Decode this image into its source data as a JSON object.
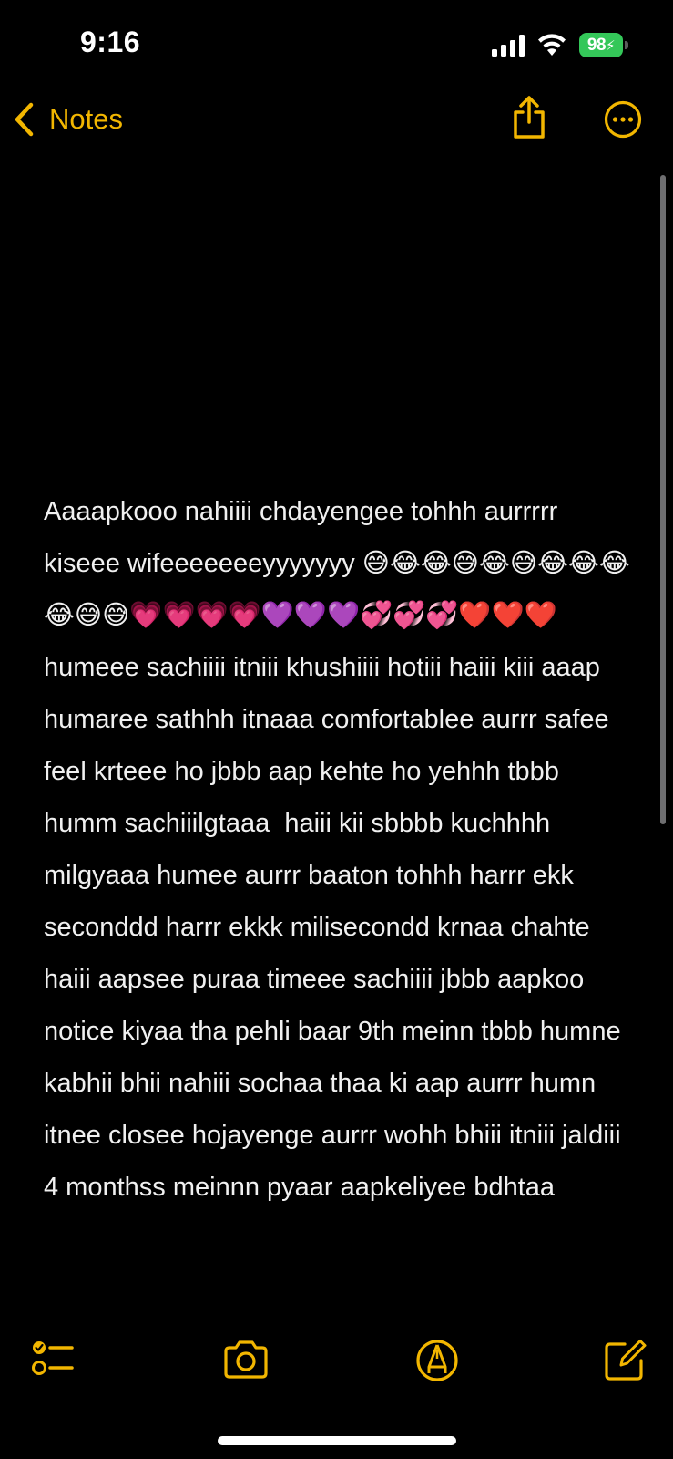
{
  "status_bar": {
    "time": "9:16",
    "battery_level": "98"
  },
  "nav": {
    "back_label": "Notes"
  },
  "note": {
    "body": "Aaaapkooo nahiiii chdayengee tohhh aurrrrr kiseee wifeeeeeeeyyyyyyy 😅😂😂😅😂😅😂😂😂😂😅😅💗💗💗💗💜💜💜💞💞💞❤️❤️❤️ humeee sachiiii itniii khushiiii hotiii haiii kiii aaap humaree sathhh itnaaa comfortablee aurrr safee feel krteee ho jbbb aap kehte ho yehhh tbbb humm sachiiilgtaaa  haiii kii sbbbb kuchhhh milgyaaa humee aurrr baaton tohhh harrr ekk seconddd harrr ekkk milisecondd krnaa chahte haiii aapsee puraa timeee sachiiii jbbb aapkoo notice kiyaa tha pehli baar 9th meinn tbbb humne kabhii bhii nahiii sochaa thaa ki aap aurrr humn itnee closee hojayenge aurrr wohh bhiii itniii jaldiii 4 monthss meinnn pyaar aapkeliyee bdhtaa"
  },
  "colors": {
    "accent": "#f2b600",
    "background": "#000000",
    "text": "#f0f0f0",
    "battery": "#34c759"
  },
  "icons": {
    "back": "chevron-left-icon",
    "share": "share-icon",
    "more": "ellipsis-circle-icon",
    "checklist": "checklist-icon",
    "camera": "camera-icon",
    "markup": "markup-pen-icon",
    "compose": "compose-icon"
  }
}
